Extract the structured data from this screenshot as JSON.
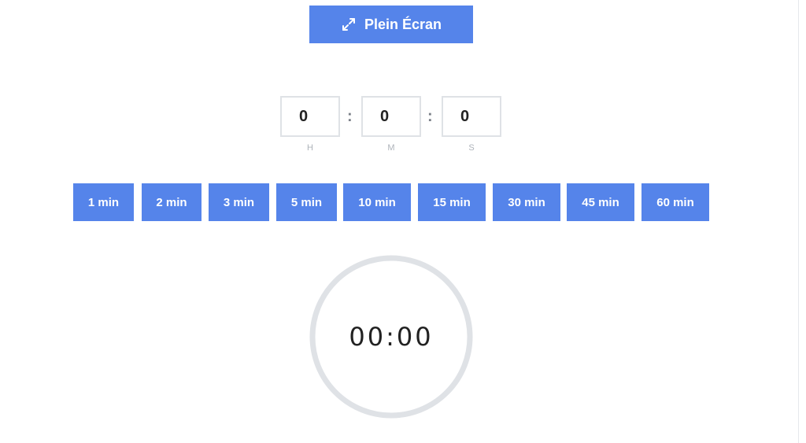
{
  "header": {
    "fullscreen_label": "Plein Écran",
    "fullscreen_icon": "expand-arrows-icon"
  },
  "timer_inputs": {
    "hours": {
      "value": "0",
      "unit": "H"
    },
    "minutes": {
      "value": "0",
      "unit": "M"
    },
    "seconds": {
      "value": "0",
      "unit": "S"
    },
    "separator": ":"
  },
  "presets": [
    {
      "label": "1 min"
    },
    {
      "label": "2 min"
    },
    {
      "label": "3 min"
    },
    {
      "label": "5 min"
    },
    {
      "label": "10 min"
    },
    {
      "label": "15 min"
    },
    {
      "label": "30 min"
    },
    {
      "label": "45 min"
    },
    {
      "label": "60 min"
    }
  ],
  "countdown": {
    "display": "00:00",
    "progress": 0
  },
  "colors": {
    "accent": "#5584ea",
    "ring": "#dfe2e6",
    "text": "#222222",
    "muted": "#aeb3ba"
  }
}
